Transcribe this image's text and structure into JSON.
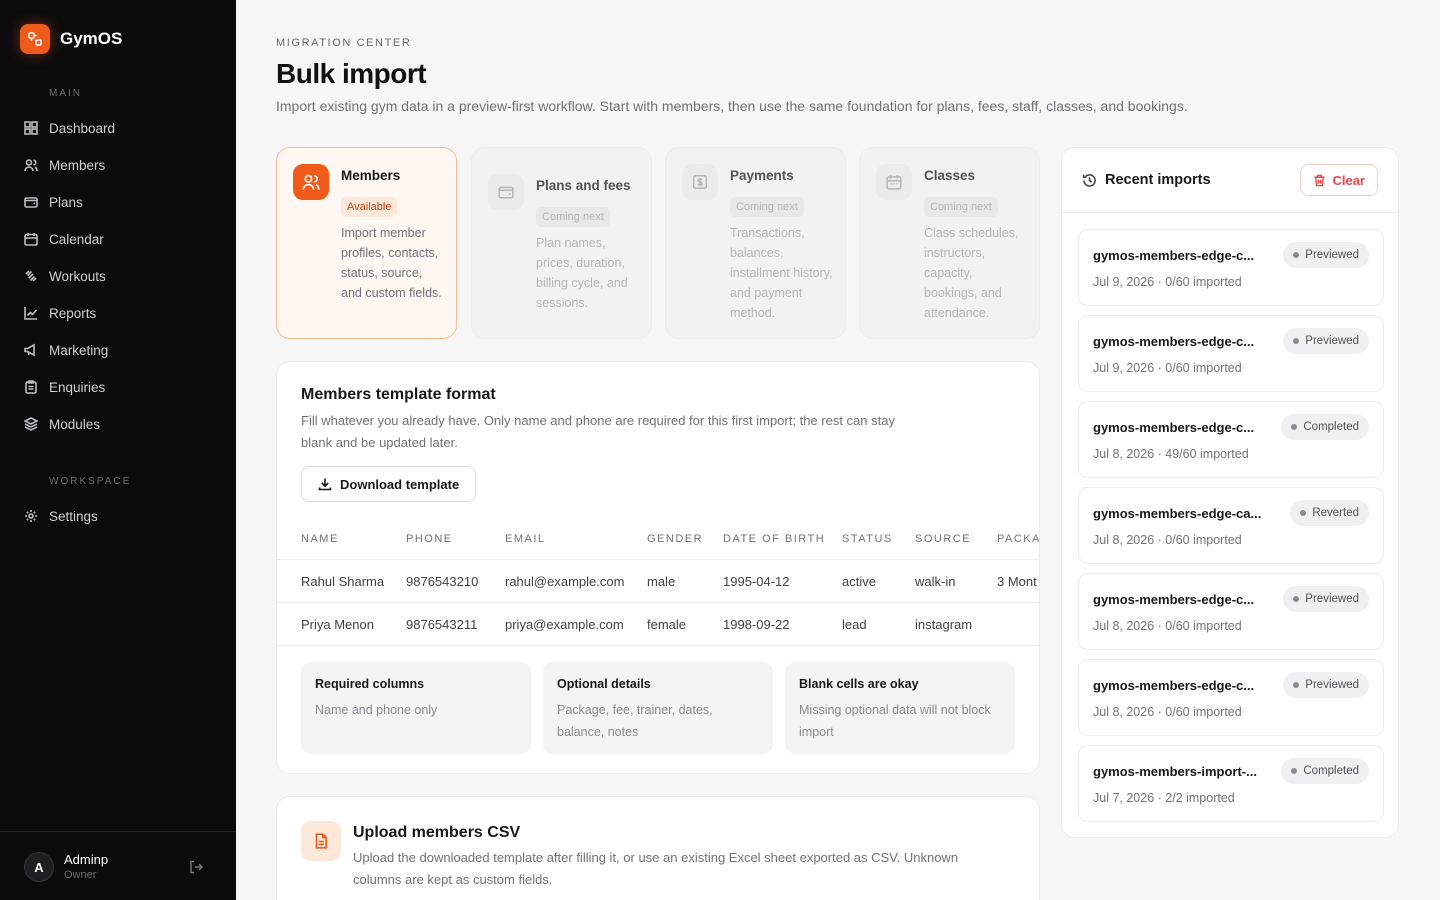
{
  "app": {
    "name": "GymOS"
  },
  "sidebar": {
    "section_main": "MAIN",
    "section_workspace": "WORKSPACE",
    "items": [
      {
        "label": "Dashboard",
        "icon": "grid-icon"
      },
      {
        "label": "Members",
        "icon": "users-icon"
      },
      {
        "label": "Plans",
        "icon": "wallet-icon"
      },
      {
        "label": "Calendar",
        "icon": "calendar-icon"
      },
      {
        "label": "Workouts",
        "icon": "dumbbell-icon"
      },
      {
        "label": "Reports",
        "icon": "chart-icon"
      },
      {
        "label": "Marketing",
        "icon": "megaphone-icon"
      },
      {
        "label": "Enquiries",
        "icon": "clipboard-icon"
      },
      {
        "label": "Modules",
        "icon": "layers-icon"
      }
    ],
    "workspace_items": [
      {
        "label": "Settings",
        "icon": "gear-icon"
      }
    ],
    "user": {
      "initial": "A",
      "name": "Adminp",
      "role": "Owner"
    }
  },
  "header": {
    "eyebrow": "MIGRATION CENTER",
    "title": "Bulk import",
    "description": "Import existing gym data in a preview-first workflow. Start with members, then use the same foundation for plans, fees, staff, classes, and bookings."
  },
  "import_types": [
    {
      "title": "Members",
      "badge": "Available",
      "description": "Import member profiles, contacts, status, source, and custom fields."
    },
    {
      "title": "Plans and fees",
      "badge": "Coming next",
      "description": "Plan names, prices, duration, billing cycle, and sessions."
    },
    {
      "title": "Payments",
      "badge": "Coming next",
      "description": "Transactions, balances, installment history, and payment method."
    },
    {
      "title": "Classes",
      "badge": "Coming next",
      "description": "Class schedules, instructors, capacity, bookings, and attendance."
    }
  ],
  "template": {
    "title": "Members template format",
    "description": "Fill whatever you already have. Only name and phone are required for this first import; the rest can stay blank and be updated later.",
    "download_label": "Download template",
    "columns": [
      "NAME",
      "PHONE",
      "EMAIL",
      "GENDER",
      "DATE OF BIRTH",
      "STATUS",
      "SOURCE",
      "PACKA"
    ],
    "rows": [
      [
        "Rahul Sharma",
        "9876543210",
        "rahul@example.com",
        "male",
        "1995-04-12",
        "active",
        "walk-in",
        "3 Mont"
      ],
      [
        "Priya Menon",
        "9876543211",
        "priya@example.com",
        "female",
        "1998-09-22",
        "lead",
        "instagram",
        ""
      ]
    ],
    "info": [
      {
        "title": "Required columns",
        "text": "Name and phone only"
      },
      {
        "title": "Optional details",
        "text": "Package, fee, trainer, dates, balance, notes"
      },
      {
        "title": "Blank cells are okay",
        "text": "Missing optional data will not block import"
      }
    ]
  },
  "upload": {
    "title": "Upload members CSV",
    "description": "Upload the downloaded template after filling it, or use an existing Excel sheet exported as CSV. Unknown columns are kept as custom fields."
  },
  "recent": {
    "title": "Recent imports",
    "clear_label": "Clear",
    "items": [
      {
        "name": "gymos-members-edge-c...",
        "meta": "Jul 9, 2026 · 0/60 imported",
        "status": "Previewed"
      },
      {
        "name": "gymos-members-edge-c...",
        "meta": "Jul 9, 2026 · 0/60 imported",
        "status": "Previewed"
      },
      {
        "name": "gymos-members-edge-c...",
        "meta": "Jul 8, 2026 · 49/60 imported",
        "status": "Completed"
      },
      {
        "name": "gymos-members-edge-ca...",
        "meta": "Jul 8, 2026 · 0/60 imported",
        "status": "Reverted"
      },
      {
        "name": "gymos-members-edge-c...",
        "meta": "Jul 8, 2026 · 0/60 imported",
        "status": "Previewed"
      },
      {
        "name": "gymos-members-edge-c...",
        "meta": "Jul 8, 2026 · 0/60 imported",
        "status": "Previewed"
      },
      {
        "name": "gymos-members-import-...",
        "meta": "Jul 7, 2026 · 2/2 imported",
        "status": "Completed"
      }
    ]
  },
  "colors": {
    "accent": "#f05a1a",
    "sidebar_bg": "#0b0b0c",
    "danger": "#e5484d"
  }
}
